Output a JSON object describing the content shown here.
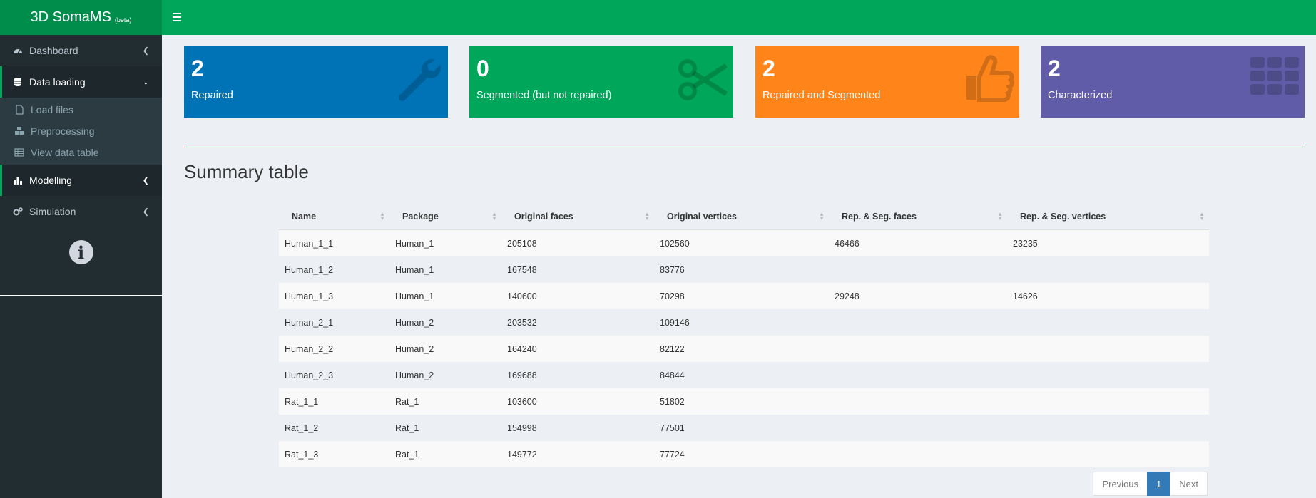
{
  "app": {
    "title": "3D SomaMS",
    "badge": "(beta)"
  },
  "sidebar": {
    "items": [
      {
        "label": "Dashboard",
        "icon": "dashboard-icon"
      },
      {
        "label": "Data loading",
        "icon": "database-icon",
        "active": true,
        "sub": [
          {
            "label": "Load files",
            "icon": "file-icon"
          },
          {
            "label": "Preprocessing",
            "icon": "cubes-icon"
          },
          {
            "label": "View data table",
            "icon": "table-icon"
          }
        ]
      },
      {
        "label": "Modelling",
        "icon": "bar-chart-icon"
      },
      {
        "label": "Simulation",
        "icon": "cogs-icon"
      }
    ],
    "info_symbol": "i"
  },
  "boxes": [
    {
      "value": "2",
      "label": "Repaired",
      "color": "#0073b7",
      "icon": "wrench-icon"
    },
    {
      "value": "0",
      "label": "Segmented (but not repaired)",
      "color": "#00a65a",
      "icon": "scissors-icon"
    },
    {
      "value": "2",
      "label": "Repaired and Segmented",
      "color": "#ff851b",
      "icon": "thumbs-up-icon"
    },
    {
      "value": "2",
      "label": "Characterized",
      "color": "#605ca8",
      "icon": "grid-icon"
    }
  ],
  "summary": {
    "title": "Summary table",
    "columns": [
      "Name",
      "Package",
      "Original faces",
      "Original vertices",
      "Rep. & Seg. faces",
      "Rep. & Seg. vertices"
    ],
    "rows": [
      [
        "Human_1_1",
        "Human_1",
        "205108",
        "102560",
        "46466",
        "23235"
      ],
      [
        "Human_1_2",
        "Human_1",
        "167548",
        "83776",
        "",
        ""
      ],
      [
        "Human_1_3",
        "Human_1",
        "140600",
        "70298",
        "29248",
        "14626"
      ],
      [
        "Human_2_1",
        "Human_2",
        "203532",
        "109146",
        "",
        ""
      ],
      [
        "Human_2_2",
        "Human_2",
        "164240",
        "82122",
        "",
        ""
      ],
      [
        "Human_2_3",
        "Human_2",
        "169688",
        "84844",
        "",
        ""
      ],
      [
        "Rat_1_1",
        "Rat_1",
        "103600",
        "51802",
        "",
        ""
      ],
      [
        "Rat_1_2",
        "Rat_1",
        "154998",
        "77501",
        "",
        ""
      ],
      [
        "Rat_1_3",
        "Rat_1",
        "149772",
        "77724",
        "",
        ""
      ]
    ]
  },
  "pagination": {
    "previous": "Previous",
    "current": "1",
    "next": "Next"
  }
}
